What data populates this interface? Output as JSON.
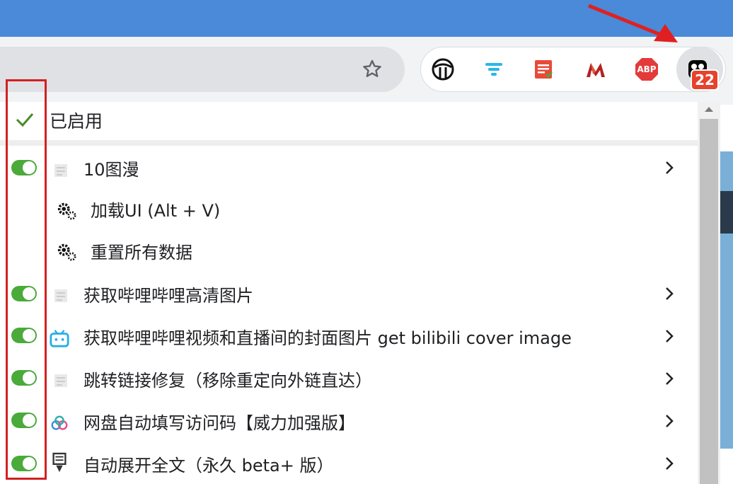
{
  "menu": {
    "header": "已启用",
    "items": [
      {
        "label": "10图漫",
        "toggle": true,
        "submenu": true,
        "icon": "page-icon"
      },
      {
        "label": "加载UI (Alt + V)",
        "toggle": false,
        "submenu": false,
        "icon": "gears-icon"
      },
      {
        "label": "重置所有数据",
        "toggle": false,
        "submenu": false,
        "icon": "gears-icon"
      },
      {
        "label": "获取哔哩哔哩高清图片",
        "toggle": true,
        "submenu": true,
        "icon": "page-icon"
      },
      {
        "label": "获取哔哩哔哩视频和直播间的封面图片 get bilibili cover image",
        "toggle": true,
        "submenu": true,
        "icon": "bilibili-icon"
      },
      {
        "label": "跳转链接修复（移除重定向外链直达）",
        "toggle": true,
        "submenu": true,
        "icon": "page-icon"
      },
      {
        "label": "网盘自动填写访问码【威力加强版】",
        "toggle": true,
        "submenu": true,
        "icon": "cloud-icon"
      },
      {
        "label": "自动展开全文（永久 beta+ 版）",
        "toggle": true,
        "submenu": true,
        "icon": "pen-icon"
      }
    ]
  },
  "extensions": {
    "items": [
      "tampermonkey-alt-icon",
      "filter-icon",
      "notes-icon",
      "m-logo-icon",
      "adblock-plus-icon",
      "tampermonkey-icon"
    ],
    "adblock_label": "ABP",
    "badge_count": "22"
  },
  "colors": {
    "toggle_on": "#4aaa3a",
    "highlight": "#d32020",
    "titlebar": "#4a8ad8",
    "badge": "#e8412c"
  }
}
